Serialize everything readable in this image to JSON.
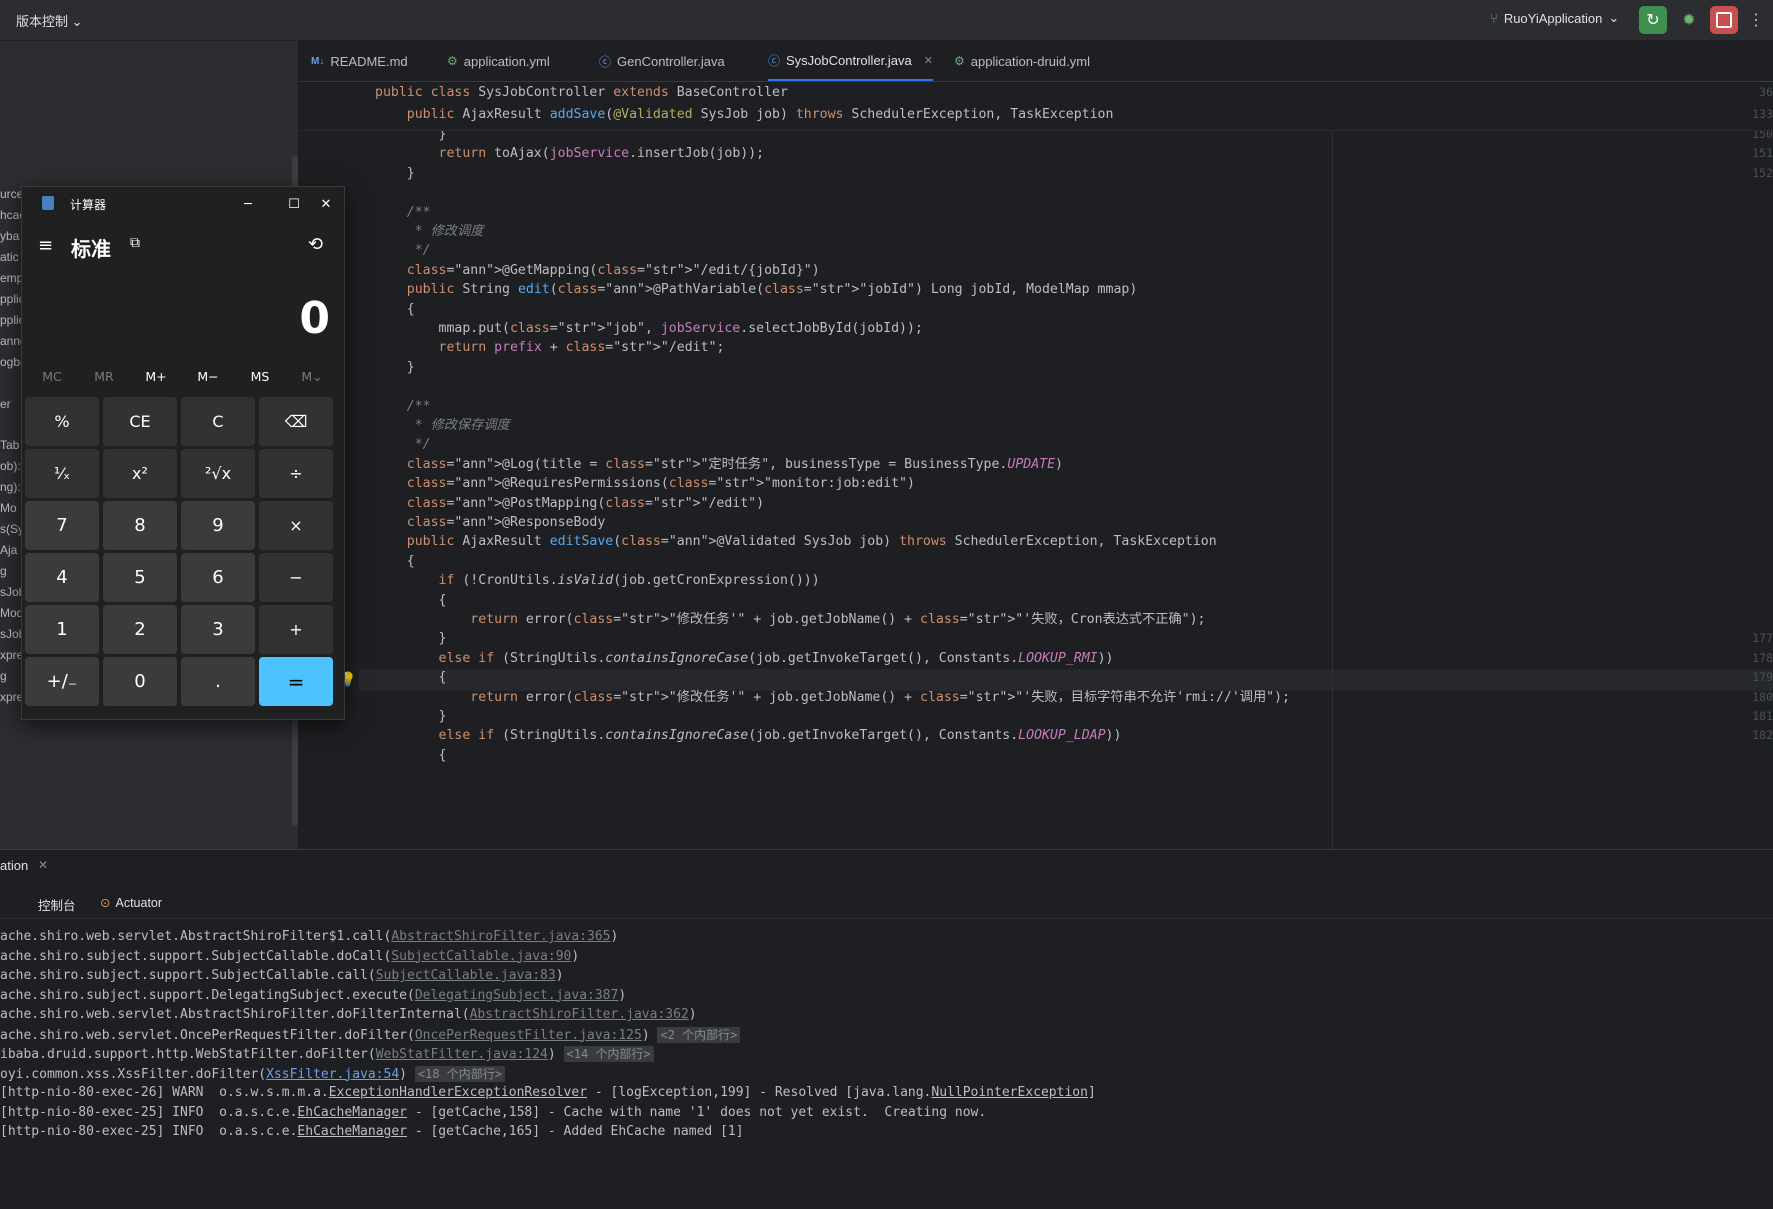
{
  "topbar": {
    "vcs_label": "版本控制 ⌄",
    "run_config": "RuoYiApplication",
    "icons": [
      "git-branch-icon",
      "rerun-icon",
      "debug-icon",
      "stop-icon",
      "more-icon"
    ],
    "colors": {
      "rerun": "#3f8f4f",
      "stop": "#c94f4f"
    }
  },
  "project_tree": [
    "urce",
    "hcac",
    "yba",
    "atic",
    "empl",
    "pplic",
    "pplic",
    "anne",
    "ogba",
    "er",
    "Tab",
    "ob):",
    "ng):",
    "Mo",
    "s(Sy",
    "Aja",
    "g",
    "sJob): AjaxResult",
    "ModelMap): String",
    "sJob): AjaxResult",
    "xpressionIsValid(SysJob): boolean",
    "g",
    "xpression(String): AjaxResult"
  ],
  "tabs": [
    {
      "label": "README.md",
      "icon": "M↓"
    },
    {
      "label": "application.yml",
      "icon": "yml-icon"
    },
    {
      "label": "GenController.java",
      "icon": "java-class-icon"
    },
    {
      "label": "SysJobController.java",
      "icon": "java-class-icon",
      "active": true,
      "close": "✕"
    },
    {
      "label": "application-druid.yml",
      "icon": "yml-icon"
    }
  ],
  "editor": {
    "sticky_lines": [
      {
        "ln": "36",
        "text": "public class SysJobController extends BaseController"
      },
      {
        "ln": "133",
        "text": "    public AjaxResult addSave(@Validated SysJob job) throws SchedulerException, TaskException"
      }
    ],
    "line_numbers": [
      "150",
      "151",
      "152",
      "",
      "",
      "",
      "",
      "",
      "",
      "",
      "",
      "",
      "",
      "",
      "",
      "",
      "",
      "",
      "",
      "",
      "",
      "",
      "",
      "",
      "",
      "",
      "177",
      "178",
      "179",
      "180",
      "181",
      "182"
    ],
    "lines": [
      "        }",
      "        return toAjax(jobService.insertJob(job));",
      "    }",
      "",
      "    /**",
      "     * 修改调度",
      "     */",
      "    @GetMapping(\"/edit/{jobId}\")",
      "    public String edit(@PathVariable(\"jobId\") Long jobId, ModelMap mmap)",
      "    {",
      "        mmap.put(\"job\", jobService.selectJobById(jobId));",
      "        return prefix + \"/edit\";",
      "    }",
      "",
      "    /**",
      "     * 修改保存调度",
      "     */",
      "    @Log(title = \"定时任务\", businessType = BusinessType.UPDATE)",
      "    @RequiresPermissions(\"monitor:job:edit\")",
      "    @PostMapping(\"/edit\")",
      "    @ResponseBody",
      "    public AjaxResult editSave(@Validated SysJob job) throws SchedulerException, TaskException",
      "    {",
      "        if (!CronUtils.isValid(job.getCronExpression()))",
      "        {",
      "            return error(\"修改任务'\" + job.getJobName() + \"'失败，Cron表达式不正确\");",
      "        }",
      "        else if (StringUtils.containsIgnoreCase(job.getInvokeTarget(), Constants.LOOKUP_RMI))",
      "        {",
      "            return error(\"修改任务'\" + job.getJobName() + \"'失败，目标字符串不允许'rmi://'调用\");",
      "        }",
      "        else if (StringUtils.containsIgnoreCase(job.getInvokeTarget(), Constants.LOOKUP_LDAP))",
      "        {"
    ]
  },
  "run_panel": {
    "title": "ation",
    "close": "✕",
    "tabs": [
      "控制台",
      "Actuator"
    ],
    "log_lines": [
      "ache.shiro.web.servlet.AbstractShiroFilter$1.call(AbstractShiroFilter.java:365)",
      "ache.shiro.subject.support.SubjectCallable.doCall(SubjectCallable.java:90)",
      "ache.shiro.subject.support.SubjectCallable.call(SubjectCallable.java:83)",
      "ache.shiro.subject.support.DelegatingSubject.execute(DelegatingSubject.java:387)",
      "ache.shiro.web.servlet.AbstractShiroFilter.doFilterInternal(AbstractShiroFilter.java:362)",
      "ache.shiro.web.servlet.OncePerRequestFilter.doFilter(OncePerRequestFilter.java:125)",
      "ibaba.druid.support.http.WebStatFilter.doFilter(WebStatFilter.java:124)",
      "oyi.common.xss.XssFilter.doFilter(XssFilter.java:54)",
      "[http-nio-80-exec-26] WARN  o.s.w.s.m.m.a.ExceptionHandlerExceptionResolver - [logException,199] - Resolved [java.lang.NullPointerException]",
      "[http-nio-80-exec-25] INFO  o.a.s.c.e.EhCacheManager - [getCache,158] - Cache with name '1' does not yet exist.  Creating now.",
      "[http-nio-80-exec-25] INFO  o.a.s.c.e.EhCacheManager - [getCache,165] - Added EhCache named [1]"
    ],
    "folds": {
      "line5": "<2 个内部行>",
      "line6": "<14 个内部行>",
      "line7": "<18 个内部行>"
    }
  },
  "calculator": {
    "title": "计算器",
    "mode": "标准",
    "display": "0",
    "memory": [
      "MC",
      "MR",
      "M+",
      "M−",
      "MS",
      "M⌄"
    ],
    "keys": [
      [
        "%",
        "CE",
        "C",
        "⌫"
      ],
      [
        "¹⁄ₓ",
        "x²",
        "²√x",
        "÷"
      ],
      [
        "7",
        "8",
        "9",
        "×"
      ],
      [
        "4",
        "5",
        "6",
        "−"
      ],
      [
        "1",
        "2",
        "3",
        "+"
      ],
      [
        "+/₋",
        "0",
        ".",
        "="
      ]
    ],
    "accent": "#4cc2ff"
  }
}
